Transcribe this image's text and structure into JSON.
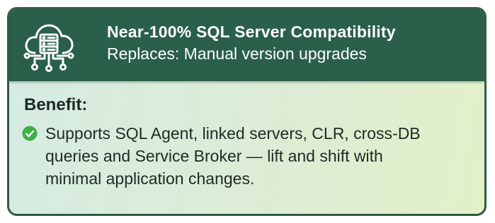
{
  "header": {
    "icon": "cloud-server-network-icon",
    "title": "Near-100% SQL Server Compatibility",
    "subtitle": "Replaces: Manual version upgrades"
  },
  "benefit": {
    "heading": "Benefit:",
    "icon": "check-circle-icon",
    "text": "Supports SQL Agent, linked servers, CLR, cross-DB queries and Service Broker — lift and shift with minimal application changes."
  },
  "colors": {
    "header_bg": "#2a5f4a",
    "border": "#2e5c45",
    "check": "#3fae45",
    "body_gradient_start": "#d6ebe3",
    "body_gradient_end": "#e3f0c9"
  }
}
